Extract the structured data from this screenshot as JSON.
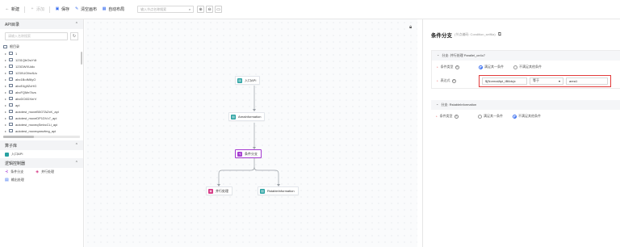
{
  "toolbar": {
    "new": "新建",
    "add": "添加",
    "save": "保存",
    "clear": "清空画布",
    "auto_layout": "自动布局",
    "search_placeholder": "输入节点名称搜索"
  },
  "sidebar": {
    "api_header": "API目录",
    "search_placeholder": "请输入名称搜索",
    "root": "根目录",
    "items": [
      "1",
      "1231QbOwY4t",
      "123GWXUdic",
      "123XUOIbcfUu",
      "abc1BoIM6yO",
      "abcE4g9ZcHG",
      "abcFQMe7kvs",
      "abcDC6DXnrV",
      "api",
      "autotest_moveB0GTAZxK_api",
      "autotest_moveDP1DVv7_api",
      "autotest_moveqSmbcCLi_api",
      "autotest_moveqamzfmg_api"
    ],
    "operator_header": "算子库",
    "operator_items": [
      "入口API"
    ],
    "logic_header": "逻辑控制器",
    "logic_items": [
      "条件分支",
      "并行处理",
      "输出处理"
    ]
  },
  "canvas": {
    "nodes": {
      "entry": "入口API",
      "area": "AreaInformation",
      "condition": "条件分支",
      "parallel": "并行处理",
      "rss": "RstableInformation"
    }
  },
  "panel": {
    "title": "条件分支",
    "subtitle": "(节点编码: Condition_seif6a)",
    "section1_title": "分支: 并行处理 Parallel_ce4c7",
    "cond_type_label": "条件类型",
    "opt_any": "满足其一条件",
    "opt_all": "不满足其他条件",
    "expr_label": "表达式",
    "expr_value": "${NormalApi_tB6dcjx",
    "expr_op": "等于",
    "expr_target": "area1",
    "section2_title": "分支: RstableInformation"
  },
  "colors": {
    "accent": "#3a6ff0",
    "teal": "#28a1a1",
    "purple": "#a43bd0",
    "pink": "#d63a86",
    "error": "#e23b3b"
  }
}
